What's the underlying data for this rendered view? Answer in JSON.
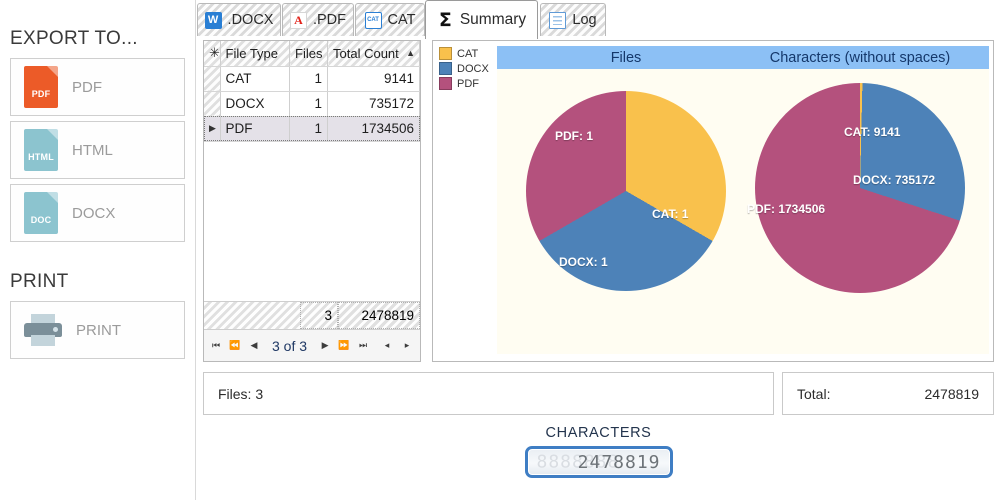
{
  "sidebar": {
    "export_title": "EXPORT TO...",
    "print_title": "PRINT",
    "export_buttons": [
      {
        "label": "PDF",
        "icon": "pdf-file-icon",
        "tag": "PDF",
        "color": "#ec5b28"
      },
      {
        "label": "HTML",
        "icon": "html-file-icon",
        "tag": "HTML",
        "color": "#8cc4cf"
      },
      {
        "label": "DOCX",
        "icon": "doc-file-icon",
        "tag": "DOC",
        "color": "#8cc4cf"
      }
    ],
    "print_button": {
      "label": "PRINT",
      "icon": "printer-icon"
    }
  },
  "tabs": [
    {
      "label": ".DOCX",
      "icon": "word-icon",
      "active": false
    },
    {
      "label": ".PDF",
      "icon": "pdf-icon",
      "active": false
    },
    {
      "label": "CAT",
      "icon": "cat-icon",
      "active": false
    },
    {
      "label": "Summary",
      "icon": "sigma-icon",
      "active": true
    },
    {
      "label": "Log",
      "icon": "log-icon",
      "active": false
    }
  ],
  "grid": {
    "columns": [
      "File Type",
      "Files",
      "Total Count"
    ],
    "sort_column": "Total Count",
    "sort_direction": "ascending",
    "rows": [
      {
        "file_type": "CAT",
        "files": "1",
        "total_count": "9141",
        "selected": false
      },
      {
        "file_type": "DOCX",
        "files": "1",
        "total_count": "735172",
        "selected": false
      },
      {
        "file_type": "PDF",
        "files": "1",
        "total_count": "1734506",
        "selected": true
      }
    ],
    "footer": {
      "files": "3",
      "total_count": "2478819"
    },
    "pager": {
      "label": "3 of 3",
      "first": "⏮",
      "prev_page": "⏪",
      "prev": "◀",
      "next": "▶",
      "next_page": "⏩",
      "last": "⏭",
      "hscroll_left": "◂",
      "hscroll_right": "▸"
    }
  },
  "legend": [
    {
      "label": "CAT",
      "color": "#f9c14c"
    },
    {
      "label": "DOCX",
      "color": "#4d82b8"
    },
    {
      "label": "PDF",
      "color": "#b4517d"
    }
  ],
  "status": {
    "files_label": "Files: 3",
    "total_label": "Total:",
    "total_value": "2478819"
  },
  "counter": {
    "label": "CHARACTERS",
    "value": "2478819",
    "ghost": "8888888"
  },
  "chart_data": [
    {
      "type": "pie",
      "title": "Files",
      "categories": [
        "CAT",
        "DOCX",
        "PDF"
      ],
      "values": [
        1,
        1,
        1
      ],
      "labels": [
        "CAT: 1",
        "DOCX: 1",
        "PDF: 1"
      ],
      "colors": [
        "#f9c14c",
        "#4d82b8",
        "#b4517d"
      ],
      "legend": "outside-left",
      "start_angle": 0
    },
    {
      "type": "pie",
      "title": "Characters (without spaces)",
      "categories": [
        "CAT",
        "DOCX",
        "PDF"
      ],
      "values": [
        9141,
        735172,
        1734506
      ],
      "labels": [
        "CAT: 9141",
        "DOCX: 735172",
        "PDF: 1734506"
      ],
      "colors": [
        "#f9c14c",
        "#4d82b8",
        "#b4517d"
      ],
      "legend": "outside-left",
      "start_angle": 0
    }
  ]
}
